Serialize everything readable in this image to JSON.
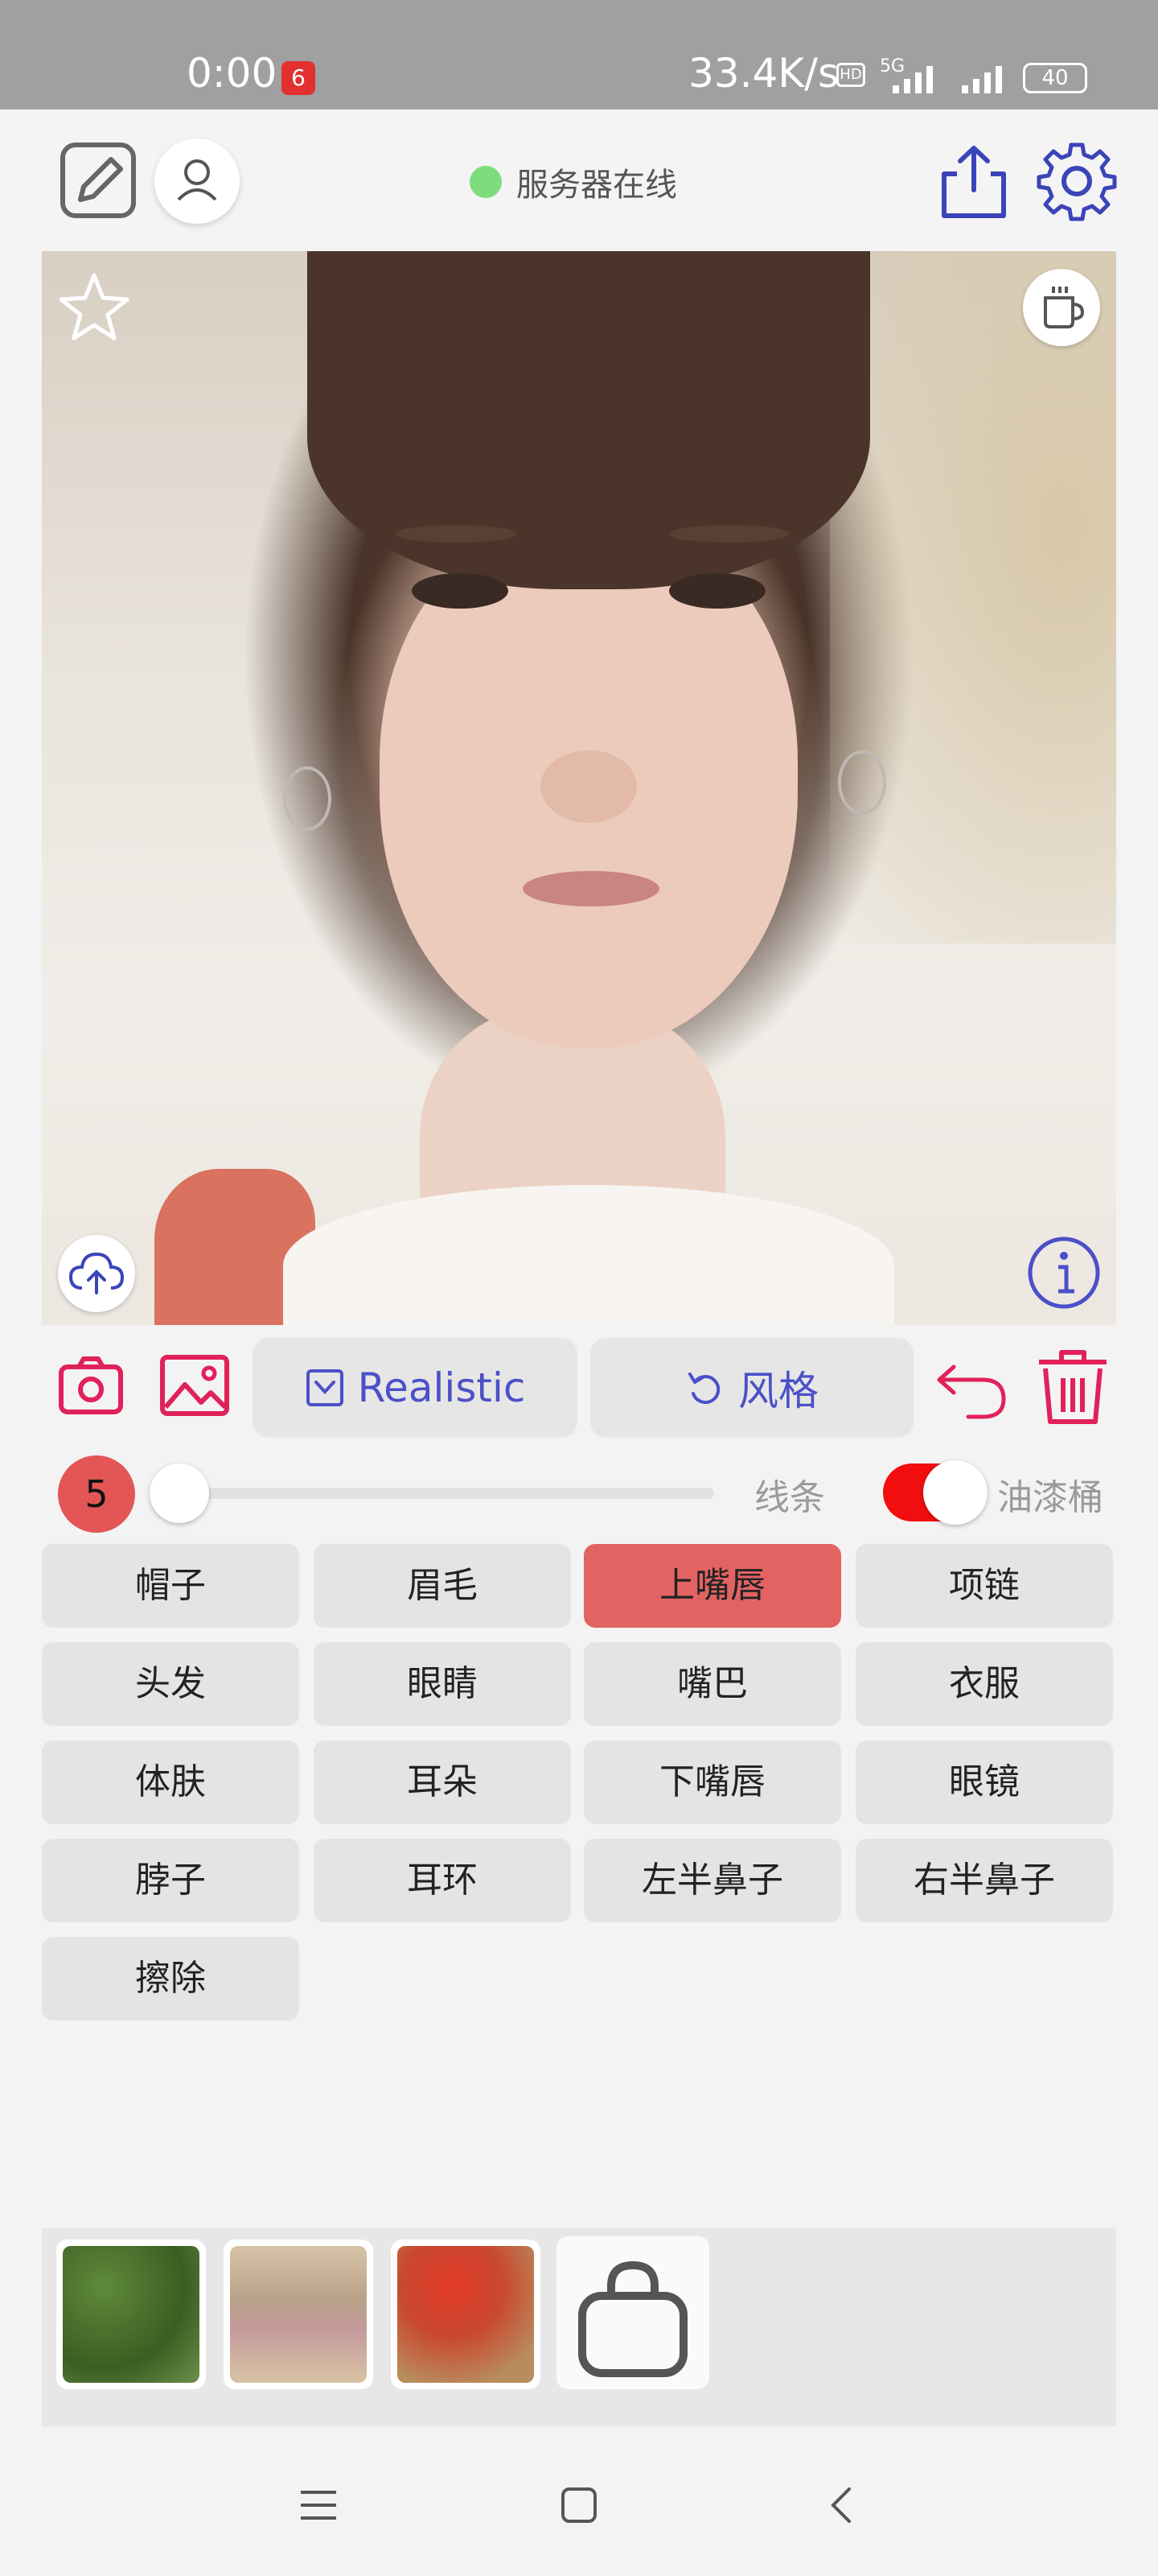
{
  "status_bar": {
    "time": "0:00",
    "app_badge": "6",
    "net_speed": "33.4K/s",
    "hd": "HD",
    "network": "5G",
    "battery": "40"
  },
  "header": {
    "server_status": "服务器在线",
    "server_color": "#7ddc7d"
  },
  "toolbar": {
    "model_label": "Realistic",
    "style_label": "风格",
    "accent": "#4b50c8",
    "icon_accent": "#e0215a"
  },
  "brush": {
    "size": "5",
    "slider_fraction": 0.0,
    "line_label": "线条",
    "bucket_label": "油漆桶",
    "bucket_on": true
  },
  "parts": [
    {
      "label": "帽子",
      "active": false
    },
    {
      "label": "眉毛",
      "active": false
    },
    {
      "label": "上嘴唇",
      "active": true
    },
    {
      "label": "项链",
      "active": false
    },
    {
      "label": "头发",
      "active": false
    },
    {
      "label": "眼睛",
      "active": false
    },
    {
      "label": "嘴巴",
      "active": false
    },
    {
      "label": "衣服",
      "active": false
    },
    {
      "label": "体肤",
      "active": false
    },
    {
      "label": "耳朵",
      "active": false
    },
    {
      "label": "下嘴唇",
      "active": false
    },
    {
      "label": "眼镜",
      "active": false
    },
    {
      "label": "脖子",
      "active": false
    },
    {
      "label": "耳环",
      "active": false
    },
    {
      "label": "左半鼻子",
      "active": false
    },
    {
      "label": "右半鼻子",
      "active": false
    },
    {
      "label": "擦除",
      "active": false
    }
  ],
  "icons": {
    "edit": "edit-icon",
    "avatar": "user-icon",
    "share": "share-icon",
    "settings": "gear-icon",
    "favorite": "star-icon",
    "coffee": "coffee-icon",
    "upload": "cloud-upload-icon",
    "info": "info-icon",
    "camera": "camera-icon",
    "gallery": "image-icon",
    "undo": "undo-icon",
    "trash": "trash-icon",
    "bag": "shopping-bag-icon"
  }
}
